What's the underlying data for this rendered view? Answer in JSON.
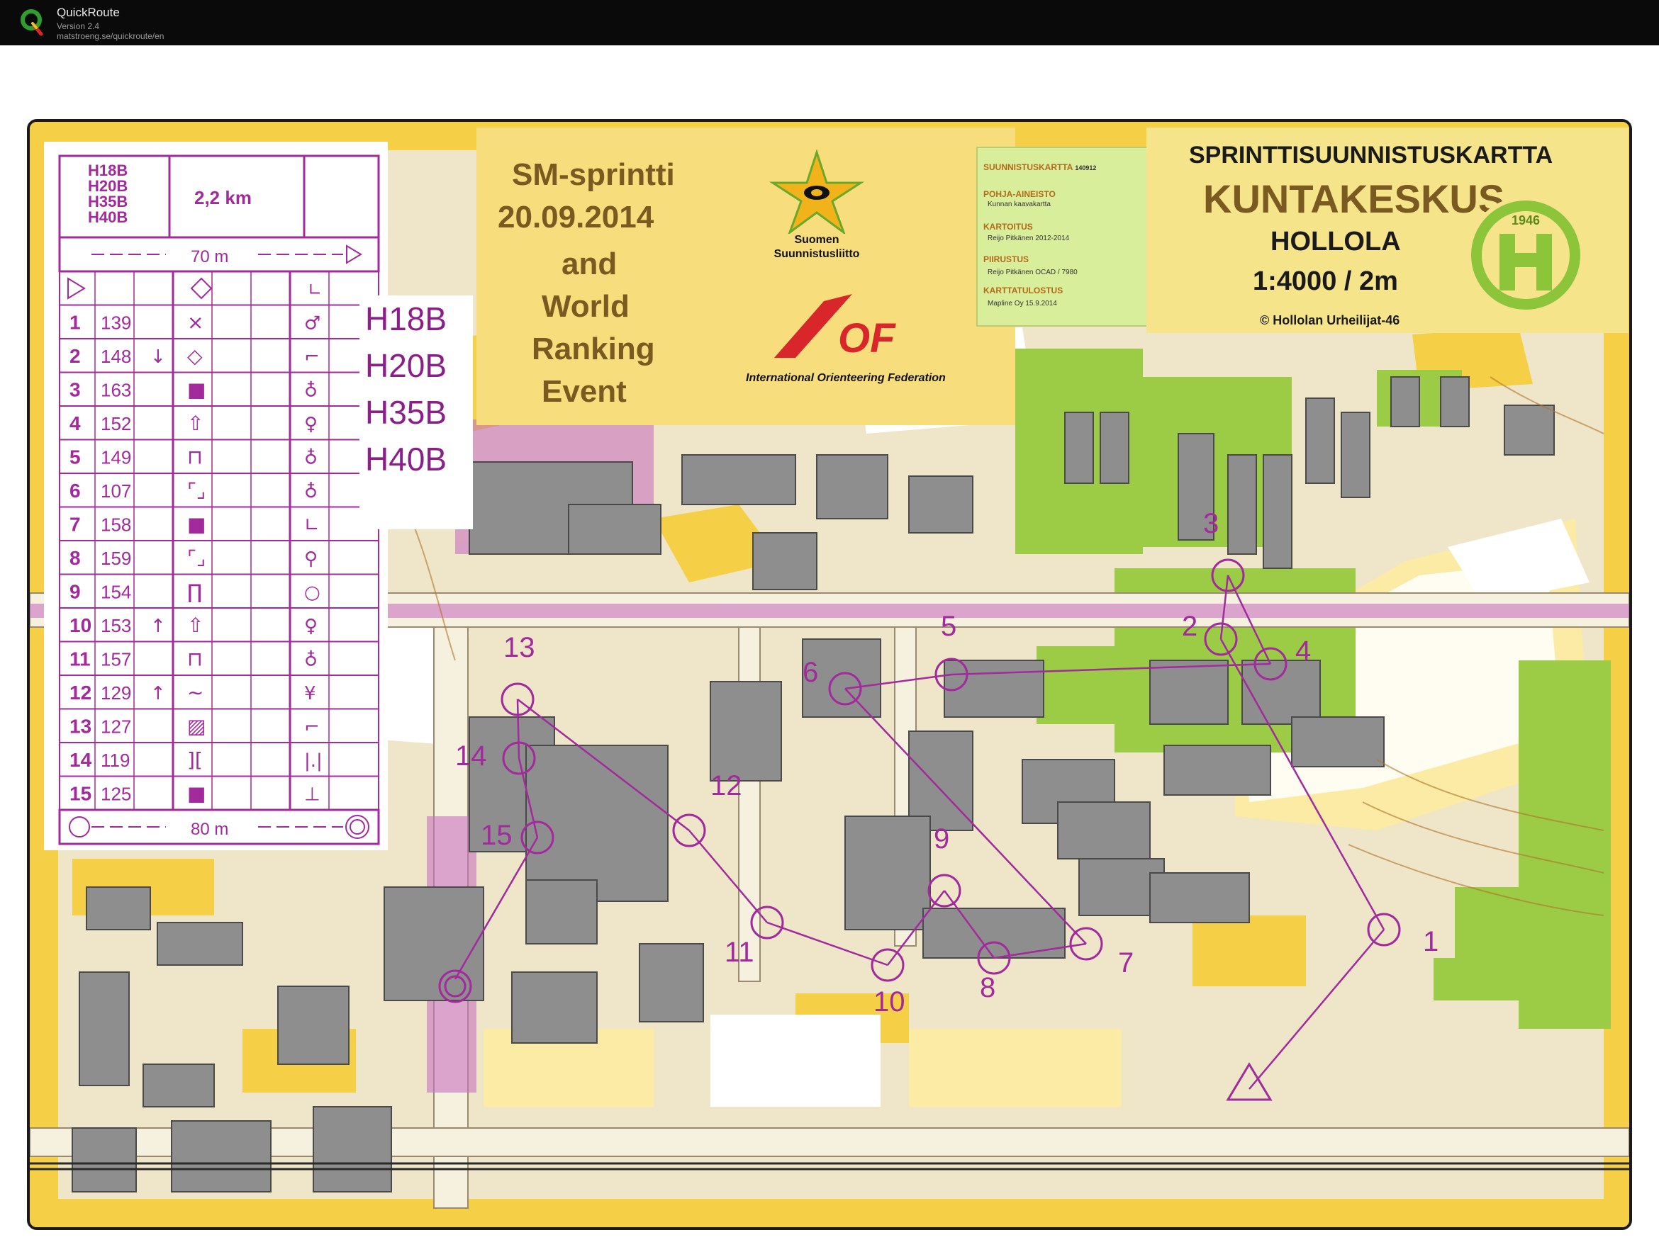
{
  "app": {
    "name": "QuickRoute",
    "version": "Version 2.4",
    "url": "matstroeng.se/quickroute/en"
  },
  "event": {
    "line1": "SM-sprintti",
    "line2": "20.09.2014",
    "line3": "and",
    "line4": "World",
    "line5": "Ranking",
    "line6": "Event",
    "ssl_line1": "Suomen",
    "ssl_line2": "Suunnistusliitto",
    "iof_logo_text": "IOF",
    "iof_name": "International Orienteering Federation"
  },
  "info": {
    "h1": "SUUNNISTUSKARTTA",
    "h1_code": "140912",
    "h2": "POHJA-AINEISTO",
    "v2": "Kunnan kaavakartta",
    "h3": "KARTOITUS",
    "v3": "Reijo Pitkänen 2012-2014",
    "h4": "PIIRUSTUS",
    "v4": "Reijo Pitkänen OCAD / 7980",
    "h5": "KARTTATULOSTUS",
    "v5": "Mapline Oy 15.9.2014"
  },
  "map_header": {
    "title_small": "SPRINTTISUUNNISTUSKARTTA",
    "title_big": "KUNTAKESKUS",
    "place": "HOLLOLA",
    "scale": "1:4000 / 2m",
    "copyright": "©  Hollolan Urheilijat-46",
    "emblem_year": "1946",
    "emblem_letter": "H"
  },
  "course_groups": [
    "H18B",
    "H20B",
    "H35B",
    "H40B"
  ],
  "description_sheet": {
    "classes": [
      "H18B",
      "H20B",
      "H35B",
      "H40B"
    ],
    "length": "2,2 km",
    "start_taping": "70 m",
    "finish_taping": "80 m",
    "controls": [
      {
        "num": "1",
        "code": "139",
        "dir": "",
        "feature": "×",
        "loc": "♂"
      },
      {
        "num": "2",
        "code": "148",
        "dir": "↓",
        "feature": "◇",
        "loc": "⌐"
      },
      {
        "num": "3",
        "code": "163",
        "dir": "",
        "feature": "■",
        "loc": "♁"
      },
      {
        "num": "4",
        "code": "152",
        "dir": "",
        "feature": "⇧",
        "loc": "♀"
      },
      {
        "num": "5",
        "code": "149",
        "dir": "",
        "feature": "⊓",
        "loc": "♁"
      },
      {
        "num": "6",
        "code": "107",
        "dir": "",
        "feature": "⌜⌟",
        "loc": "♁"
      },
      {
        "num": "7",
        "code": "158",
        "dir": "",
        "feature": "■",
        "loc": "∟"
      },
      {
        "num": "8",
        "code": "159",
        "dir": "",
        "feature": "⌜⌟",
        "loc": "⚲"
      },
      {
        "num": "9",
        "code": "154",
        "dir": "",
        "feature": "∏",
        "loc": "○"
      },
      {
        "num": "10",
        "code": "153",
        "dir": "↑",
        "feature": "⇧",
        "loc": "♀"
      },
      {
        "num": "11",
        "code": "157",
        "dir": "",
        "feature": "⊓",
        "loc": "♁"
      },
      {
        "num": "12",
        "code": "129",
        "dir": "↑",
        "feature": "∼",
        "loc": "¥"
      },
      {
        "num": "13",
        "code": "127",
        "dir": "",
        "feature": "▨",
        "loc": "⌐"
      },
      {
        "num": "14",
        "code": "119",
        "dir": "",
        "feature": "][",
        "loc": "|.|"
      },
      {
        "num": "15",
        "code": "125",
        "dir": "",
        "feature": "■",
        "loc": "⊥"
      }
    ]
  },
  "course": {
    "start_label": "",
    "control_labels": [
      "1",
      "2",
      "3",
      "4",
      "5",
      "6",
      "7",
      "8",
      "9",
      "10",
      "11",
      "12",
      "13",
      "14",
      "15"
    ]
  },
  "colors": {
    "purple": "#a22a9c",
    "open_land": "#f7d24a",
    "rough_open": "#fbe9a0",
    "forest": "#ffffff",
    "green": "#8cc43a",
    "building": "#8e8e8e",
    "paved": "#ece2c8",
    "background_frame": "#1a1a1a"
  }
}
